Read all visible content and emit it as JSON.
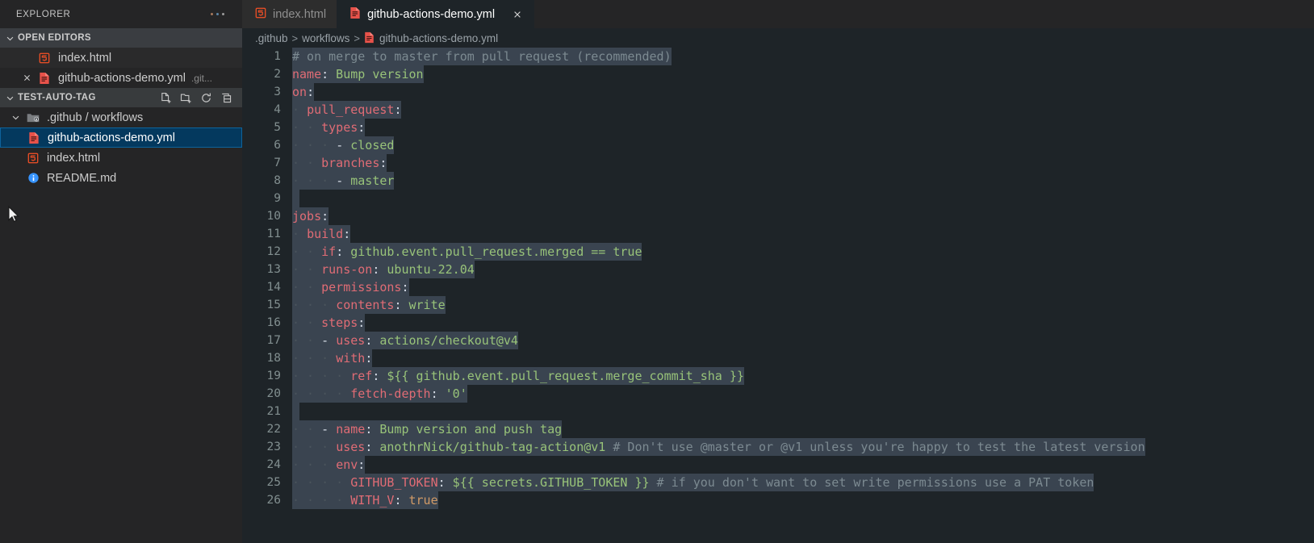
{
  "sidebar": {
    "title": "EXPLORER",
    "more_icon": "ellipsis-icon",
    "open_editors": {
      "label": "OPEN EDITORS",
      "items": [
        {
          "name": "index.html",
          "icon": "html5-file-icon",
          "desc": "",
          "close": false
        },
        {
          "name": "github-actions-demo.yml",
          "icon": "yaml-file-icon",
          "desc": ".git...",
          "close": true
        }
      ]
    },
    "workspace": {
      "label": "TEST-AUTO-TAG",
      "actions": [
        "new-file-icon",
        "new-folder-icon",
        "refresh-icon",
        "collapse-all-icon"
      ],
      "tree": [
        {
          "name": ".github / workflows",
          "icon": "folder-github-icon",
          "type": "folder",
          "expanded": true,
          "depth": 0,
          "selected": false
        },
        {
          "name": "github-actions-demo.yml",
          "icon": "yaml-file-icon",
          "type": "file",
          "depth": 1,
          "selected": true
        },
        {
          "name": "index.html",
          "icon": "html5-file-icon",
          "type": "file",
          "depth": 0,
          "selected": false
        },
        {
          "name": "README.md",
          "icon": "info-markdown-icon",
          "type": "file",
          "depth": 0,
          "selected": false
        }
      ]
    }
  },
  "tabs": [
    {
      "label": "index.html",
      "icon": "html5-file-icon",
      "active": false,
      "closable": false
    },
    {
      "label": "github-actions-demo.yml",
      "icon": "yaml-file-icon",
      "active": true,
      "closable": true
    }
  ],
  "breadcrumb": {
    "parts": [
      ".github",
      "workflows",
      "github-actions-demo.yml"
    ],
    "separator": ">",
    "file_icon": "yaml-file-icon"
  },
  "editor": {
    "language": "yaml",
    "first_line": 1,
    "last_line": 26,
    "selection_all": true,
    "colors": {
      "background": "#1e2428",
      "selection": "#3a4450",
      "keyword": "#e06c75",
      "string": "#98c379",
      "comment": "#7c8a91",
      "boolean": "#d19a66",
      "line_number": "#93a1a1",
      "tree_selected_bg": "#04395e",
      "tree_selected_border": "#0e639c"
    },
    "lines": [
      {
        "n": 1,
        "indent": 0,
        "tokens": [
          {
            "t": "comment",
            "v": "# on merge to master from pull request (recommended)"
          }
        ]
      },
      {
        "n": 2,
        "indent": 0,
        "tokens": [
          {
            "t": "key",
            "v": "name"
          },
          {
            "t": "punct",
            "v": ":"
          },
          {
            "t": "str",
            "v": " Bump version"
          }
        ]
      },
      {
        "n": 3,
        "indent": 0,
        "tokens": [
          {
            "t": "key",
            "v": "on"
          },
          {
            "t": "punct",
            "v": ":"
          }
        ]
      },
      {
        "n": 4,
        "indent": 2,
        "tokens": [
          {
            "t": "key",
            "v": "pull_request"
          },
          {
            "t": "punct",
            "v": ":"
          }
        ]
      },
      {
        "n": 5,
        "indent": 4,
        "tokens": [
          {
            "t": "key",
            "v": "types"
          },
          {
            "t": "punct",
            "v": ":"
          }
        ]
      },
      {
        "n": 6,
        "indent": 6,
        "tokens": [
          {
            "t": "punct",
            "v": "- "
          },
          {
            "t": "str",
            "v": "closed"
          }
        ]
      },
      {
        "n": 7,
        "indent": 4,
        "tokens": [
          {
            "t": "key",
            "v": "branches"
          },
          {
            "t": "punct",
            "v": ":"
          }
        ]
      },
      {
        "n": 8,
        "indent": 6,
        "tokens": [
          {
            "t": "punct",
            "v": "- "
          },
          {
            "t": "str",
            "v": "master"
          }
        ]
      },
      {
        "n": 9,
        "indent": 0,
        "tokens": []
      },
      {
        "n": 10,
        "indent": 0,
        "tokens": [
          {
            "t": "key",
            "v": "jobs"
          },
          {
            "t": "punct",
            "v": ":"
          }
        ]
      },
      {
        "n": 11,
        "indent": 2,
        "tokens": [
          {
            "t": "key",
            "v": "build"
          },
          {
            "t": "punct",
            "v": ":"
          }
        ]
      },
      {
        "n": 12,
        "indent": 4,
        "tokens": [
          {
            "t": "key",
            "v": "if"
          },
          {
            "t": "punct",
            "v": ":"
          },
          {
            "t": "str",
            "v": " github.event.pull_request.merged == true"
          }
        ]
      },
      {
        "n": 13,
        "indent": 4,
        "tokens": [
          {
            "t": "key",
            "v": "runs-on"
          },
          {
            "t": "punct",
            "v": ":"
          },
          {
            "t": "str",
            "v": " ubuntu-22.04"
          }
        ]
      },
      {
        "n": 14,
        "indent": 4,
        "tokens": [
          {
            "t": "key",
            "v": "permissions"
          },
          {
            "t": "punct",
            "v": ":"
          }
        ]
      },
      {
        "n": 15,
        "indent": 6,
        "tokens": [
          {
            "t": "key",
            "v": "contents"
          },
          {
            "t": "punct",
            "v": ":"
          },
          {
            "t": "str",
            "v": " write"
          }
        ]
      },
      {
        "n": 16,
        "indent": 4,
        "tokens": [
          {
            "t": "key",
            "v": "steps"
          },
          {
            "t": "punct",
            "v": ":"
          }
        ]
      },
      {
        "n": 17,
        "indent": 4,
        "tokens": [
          {
            "t": "punct",
            "v": "- "
          },
          {
            "t": "key",
            "v": "uses"
          },
          {
            "t": "punct",
            "v": ":"
          },
          {
            "t": "str",
            "v": " actions/checkout@v4"
          }
        ]
      },
      {
        "n": 18,
        "indent": 6,
        "tokens": [
          {
            "t": "key",
            "v": "with"
          },
          {
            "t": "punct",
            "v": ":"
          }
        ]
      },
      {
        "n": 19,
        "indent": 8,
        "tokens": [
          {
            "t": "key",
            "v": "ref"
          },
          {
            "t": "punct",
            "v": ":"
          },
          {
            "t": "str",
            "v": " ${{ github.event.pull_request.merge_commit_sha }}"
          }
        ]
      },
      {
        "n": 20,
        "indent": 8,
        "tokens": [
          {
            "t": "key",
            "v": "fetch-depth"
          },
          {
            "t": "punct",
            "v": ":"
          },
          {
            "t": "str",
            "v": " '0'"
          }
        ]
      },
      {
        "n": 21,
        "indent": 0,
        "tokens": []
      },
      {
        "n": 22,
        "indent": 4,
        "tokens": [
          {
            "t": "punct",
            "v": "- "
          },
          {
            "t": "key",
            "v": "name"
          },
          {
            "t": "punct",
            "v": ":"
          },
          {
            "t": "str",
            "v": " Bump version and push tag"
          }
        ]
      },
      {
        "n": 23,
        "indent": 6,
        "tokens": [
          {
            "t": "key",
            "v": "uses"
          },
          {
            "t": "punct",
            "v": ":"
          },
          {
            "t": "str",
            "v": " anothrNick/github-tag-action@v1"
          },
          {
            "t": "comment",
            "v": " # Don't use @master or @v1 unless you're happy to test the latest version"
          }
        ]
      },
      {
        "n": 24,
        "indent": 6,
        "tokens": [
          {
            "t": "key",
            "v": "env"
          },
          {
            "t": "punct",
            "v": ":"
          }
        ]
      },
      {
        "n": 25,
        "indent": 8,
        "tokens": [
          {
            "t": "key",
            "v": "GITHUB_TOKEN"
          },
          {
            "t": "punct",
            "v": ":"
          },
          {
            "t": "str",
            "v": " ${{ secrets.GITHUB_TOKEN }}"
          },
          {
            "t": "comment",
            "v": " # if you don't want to set write permissions use a PAT token"
          }
        ]
      },
      {
        "n": 26,
        "indent": 8,
        "tokens": [
          {
            "t": "key",
            "v": "WITH_V"
          },
          {
            "t": "punct",
            "v": ":"
          },
          {
            "t": "bool",
            "v": " true"
          }
        ]
      }
    ]
  }
}
